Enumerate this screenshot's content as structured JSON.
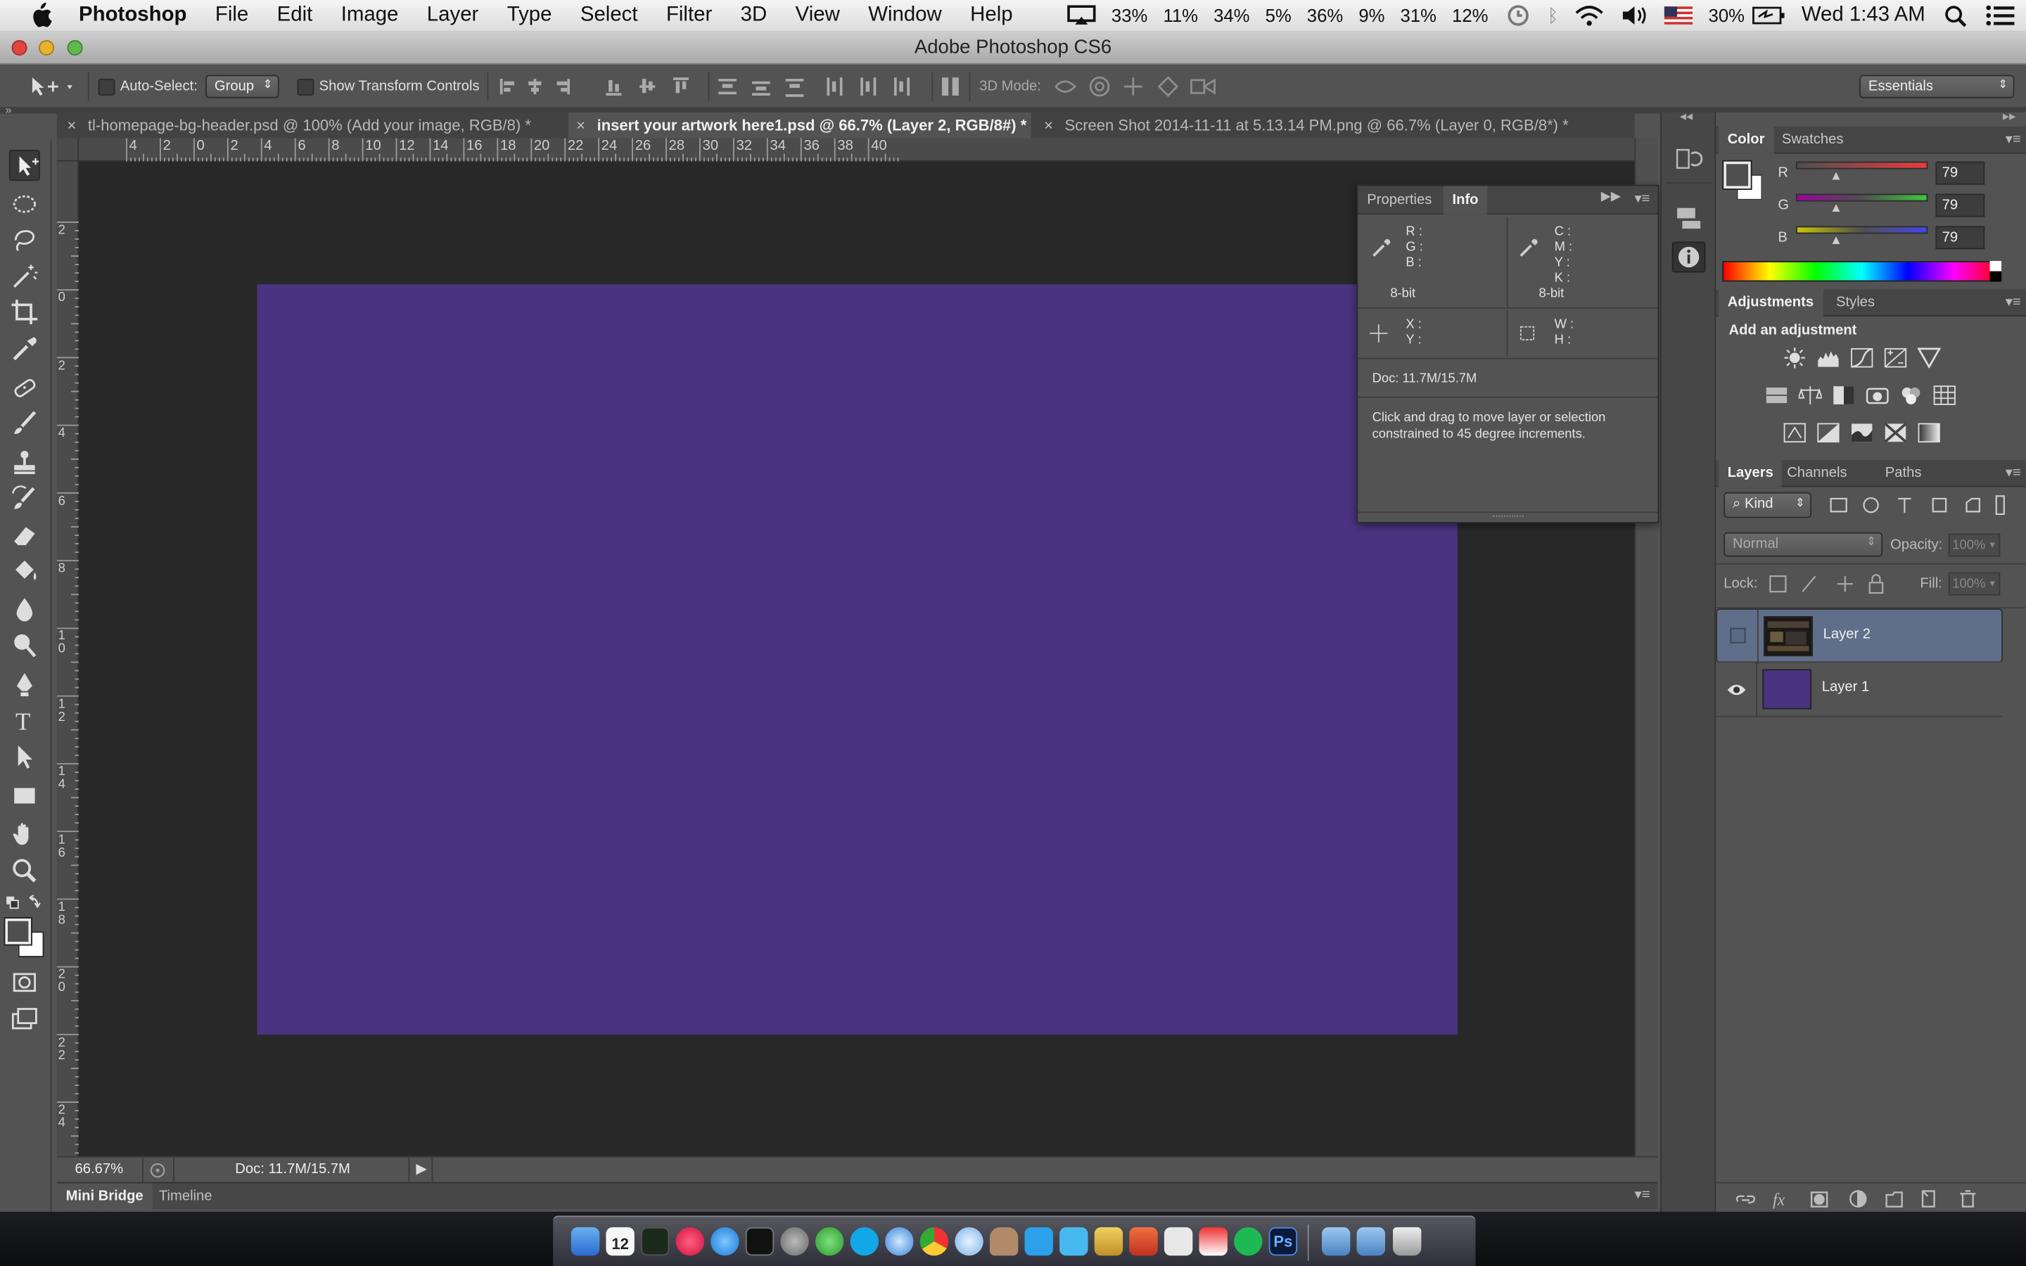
{
  "menubar": {
    "app_name": "Photoshop",
    "items": [
      "File",
      "Edit",
      "Image",
      "Layer",
      "Type",
      "Select",
      "Filter",
      "3D",
      "View",
      "Window",
      "Help"
    ],
    "status": {
      "cpu_stats": [
        "33%",
        "11%",
        "34%",
        "5%",
        "36%",
        "9%",
        "31%",
        "12%"
      ],
      "battery": "30%",
      "clock": "Wed 1:43 AM"
    }
  },
  "window": {
    "title": "Adobe Photoshop CS6"
  },
  "options_bar": {
    "auto_select_label": "Auto-Select:",
    "auto_select_value": "Group",
    "transform_label": "Show Transform Controls",
    "mode_3d_label": "3D Mode:",
    "workspace": "Essentials"
  },
  "tabs": [
    {
      "label": "tl-homepage-bg-header.psd @ 100% (Add your image, RGB/8) *",
      "active": false
    },
    {
      "label": "insert your artwork here1.psd @ 66.7% (Layer 2, RGB/8#) *",
      "active": true
    },
    {
      "label": "Screen Shot 2014-11-11 at 5.13.14 PM.png @ 66.7% (Layer 0, RGB/8*) *",
      "active": false
    }
  ],
  "rulers": {
    "h_ticks": [
      "4",
      "2",
      "0",
      "2",
      "4",
      "6",
      "8",
      "10",
      "12",
      "14",
      "16",
      "18",
      "20",
      "22",
      "24",
      "26",
      "28",
      "30",
      "32",
      "34",
      "36",
      "38",
      "40"
    ],
    "v_ticks": [
      "2",
      "0",
      "2",
      "4",
      "6",
      "8",
      "1\n0",
      "1\n2",
      "1\n4",
      "1\n6",
      "1\n8",
      "2\n0",
      "2\n2",
      "2\n4"
    ]
  },
  "canvas": {
    "fill_color": "#4a3380"
  },
  "status_bar": {
    "zoom": "66.67%",
    "doc": "Doc: 11.7M/15.7M"
  },
  "bottom_panel": {
    "tabs": [
      "Mini Bridge",
      "Timeline"
    ]
  },
  "info_panel": {
    "tabs": [
      "Properties",
      "Info"
    ],
    "rgb_labels": [
      "R :",
      "G :",
      "B :"
    ],
    "cmyk_labels": [
      "C :",
      "M :",
      "Y :",
      "K :"
    ],
    "bit_left": "8-bit",
    "bit_right": "8-bit",
    "xy_labels": [
      "X :",
      "Y :"
    ],
    "wh_labels": [
      "W :",
      "H :"
    ],
    "doc": "Doc: 11.7M/15.7M",
    "hint": "Click and drag to move layer or selection constrained to 45 degree increments."
  },
  "color_panel": {
    "tabs": [
      "Color",
      "Swatches"
    ],
    "channels": [
      {
        "label": "R",
        "value": "79"
      },
      {
        "label": "G",
        "value": "79"
      },
      {
        "label": "B",
        "value": "79"
      }
    ]
  },
  "adjustments_panel": {
    "tabs": [
      "Adjustments",
      "Styles"
    ],
    "heading": "Add an adjustment"
  },
  "layers_panel": {
    "tabs": [
      "Layers",
      "Channels",
      "Paths"
    ],
    "filter_kind": "Kind",
    "blend_mode": "Normal",
    "opacity_label": "Opacity:",
    "opacity_value": "100%",
    "lock_label": "Lock:",
    "fill_label": "Fill:",
    "fill_value": "100%",
    "layers": [
      {
        "name": "Layer 2",
        "selected": true,
        "visible": false
      },
      {
        "name": "Layer 1",
        "selected": false,
        "visible": true
      }
    ]
  },
  "dock": {
    "calendar_day": "12"
  }
}
